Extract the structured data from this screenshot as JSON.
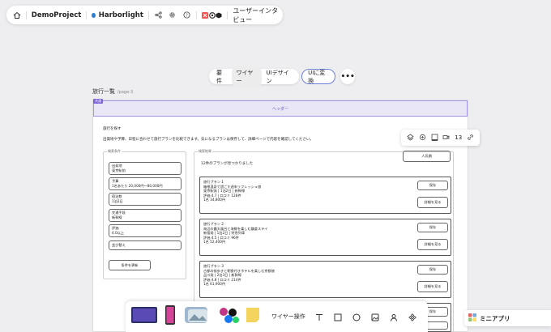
{
  "topbar": {
    "project": "DemoProject",
    "file": "Harborlight",
    "file_dot_color": "#2f7fd1",
    "page": "ユーザーインタビュー"
  },
  "mode_tabs": [
    {
      "label": "要件"
    },
    {
      "label": "ワイヤー"
    },
    {
      "label": "UIデザイン"
    }
  ],
  "convert_label": "UIに変換",
  "page_title": "旅行一覧",
  "page_id": "/page-3",
  "header_tag": "共通",
  "header_label": "ヘッダー",
  "search": {
    "heading": "旅行を探す",
    "description": "出発地や予算、日程に合わせて旅行プランを比較できます。気になるプランは保存して、詳細ページで内容を確認してください。"
  },
  "filter": {
    "legend": "検索条件",
    "fields": [
      {
        "label": "出発地",
        "value": "東京駅前"
      },
      {
        "label": "予算",
        "value": "1名あたり 20,000円〜80,000円"
      },
      {
        "label": "宿泊数",
        "value": "1泊2日"
      },
      {
        "label": "交通手段",
        "value": "新幹線"
      },
      {
        "label": "評価",
        "value": "4.0以上"
      }
    ],
    "sort": "並び替え",
    "update_button": "条件を更新"
  },
  "results": {
    "legend": "検索結果",
    "count_text": "12件のプランが見つかりました",
    "sort_label": "人気順",
    "save_label": "保存",
    "detail_label": "詳細を見る",
    "plans": [
      {
        "name": "旅行プラン 1",
        "title": "箱根温泉で過ごす週末リフレッシュ旅",
        "meta": "東京駅発 | 1泊2日 | 新幹線",
        "rating": "評価 4.7 | 口コミ 128件",
        "price": "1名 34,800円"
      },
      {
        "name": "旅行プラン 2",
        "title": "海辺の露天風呂と海鮮を楽しむ鎌倉ステイ",
        "meta": "新宿発 | 1泊2日 | 特急列車",
        "rating": "評価 4.5 | 口コミ 96件",
        "price": "1名 52,400円"
      },
      {
        "name": "旅行プラン 3",
        "title": "古都の街歩きと朝食付きホテルを楽しむ京都旅",
        "meta": "品川発 | 2泊3日 | 新幹線",
        "rating": "評価 4.8 | 口コミ 214件",
        "price": "1名 61,900円"
      }
    ]
  },
  "float_toolbar": {
    "number": "13"
  },
  "dock": {
    "label": "ワイヤー操作"
  },
  "mini_app": {
    "label": "ミニアプリ"
  }
}
